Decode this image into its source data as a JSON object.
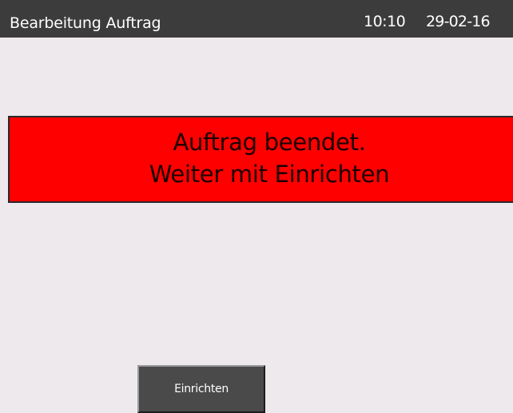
{
  "header": {
    "title": "Bearbeitung Auftrag",
    "time": "10:10",
    "date": "29-02-16"
  },
  "alert": {
    "line1": "Auftrag beendet.",
    "line2": "Weiter mit Einrichten",
    "background_color": "#ff0000"
  },
  "actions": {
    "setup_label": "Einrichten"
  },
  "colors": {
    "header_bg": "#3c3c3c",
    "page_bg": "#ede9ec",
    "button_bg": "#4a4a4a"
  }
}
